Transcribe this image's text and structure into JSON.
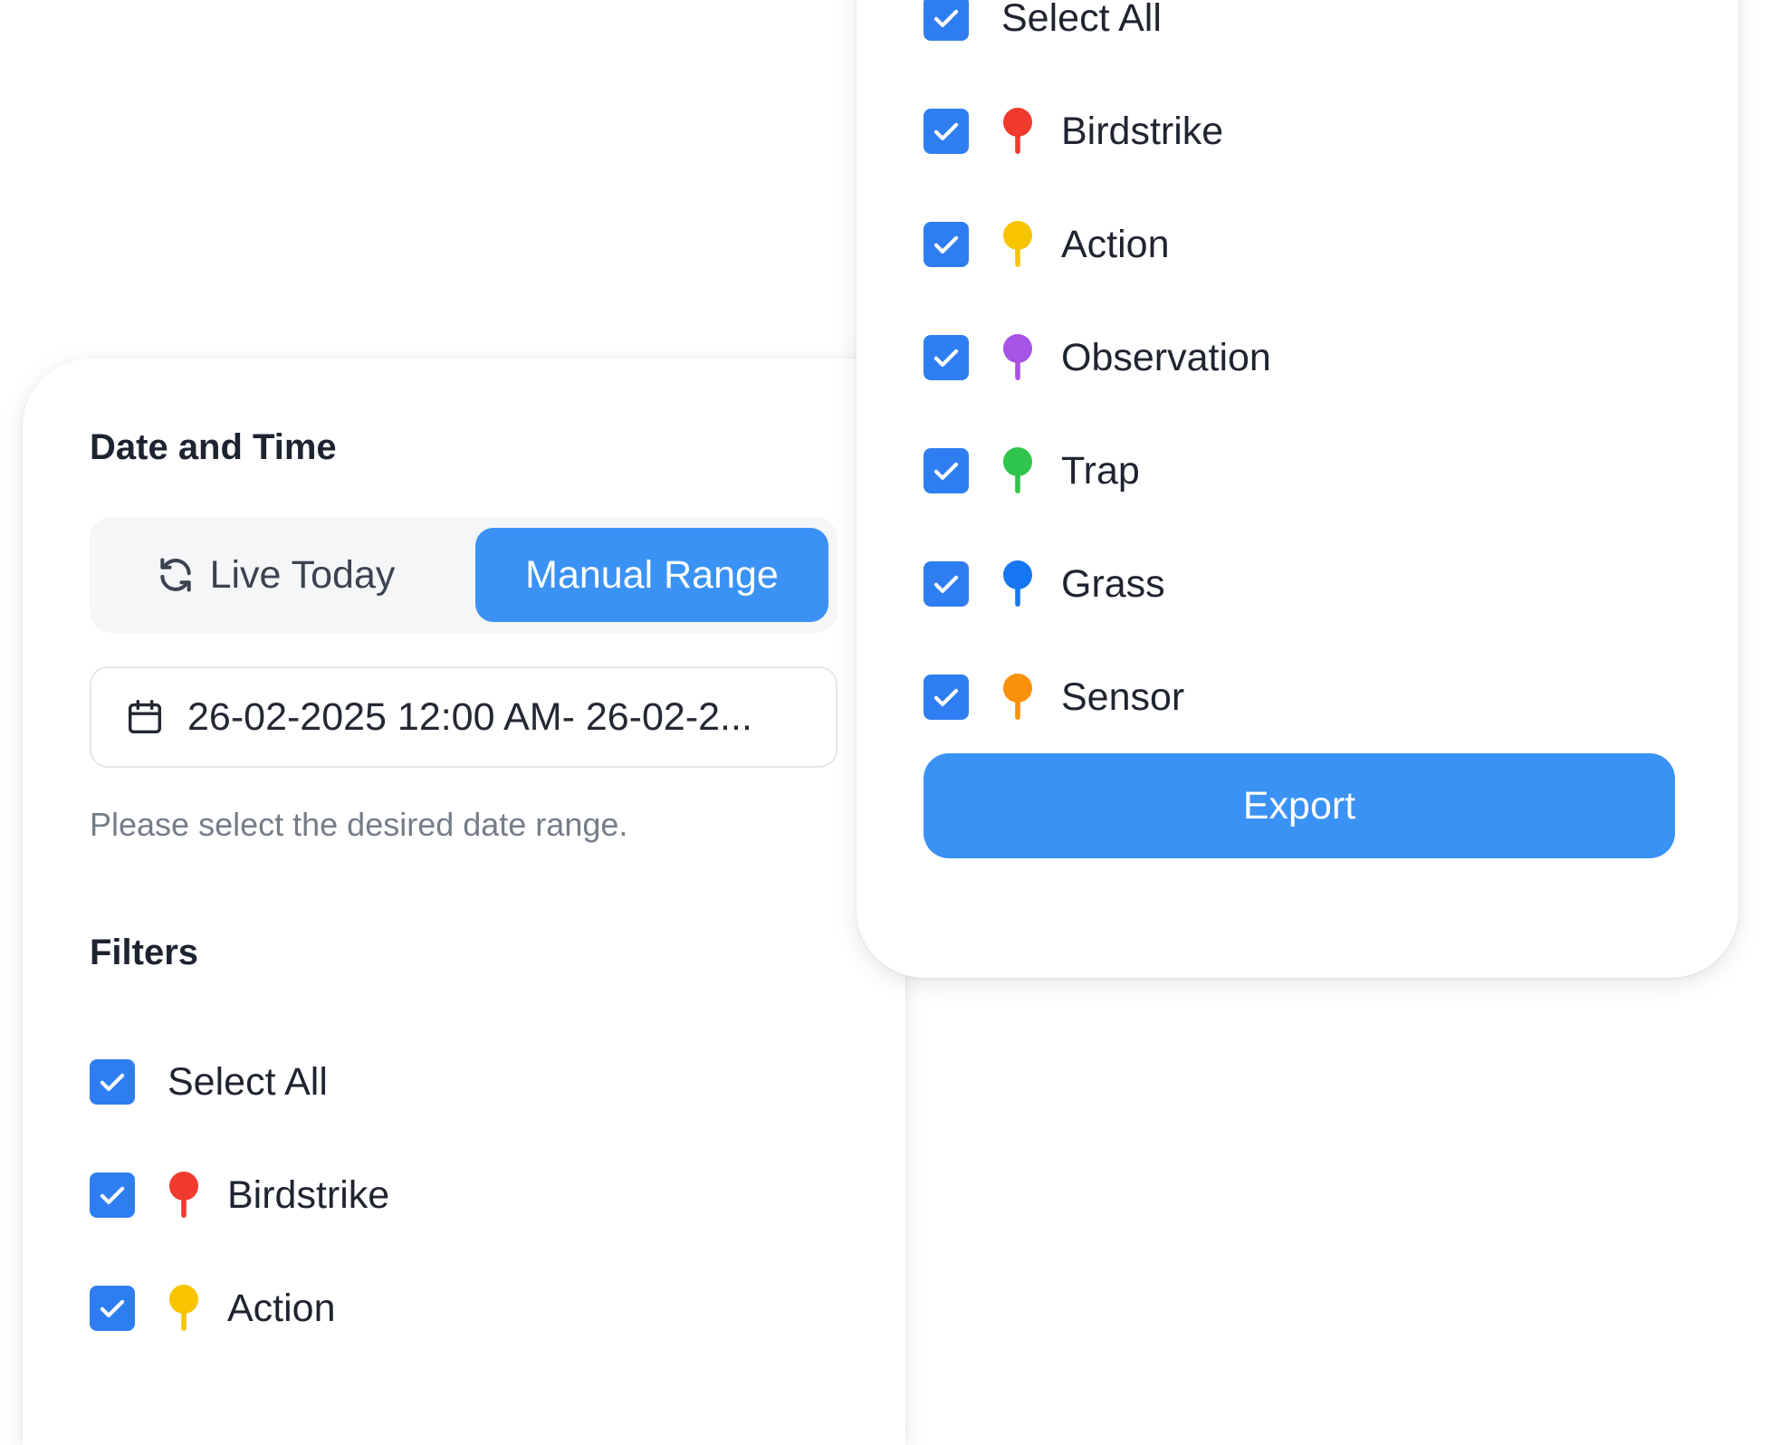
{
  "date_time_title": "Date and Time",
  "mode_toggle": {
    "live_label": "Live Today",
    "manual_label": "Manual Range",
    "selected": "Manual Range"
  },
  "date_range": {
    "value": "26-02-2025 12:00 AM- 26-02-2..."
  },
  "helper_text": "Please select the desired date range.",
  "filters_title": "Filters",
  "filters": {
    "select_all": "Select All",
    "items": [
      {
        "label": "Birdstrike",
        "color": "#f03a2e",
        "checked": true
      },
      {
        "label": "Action",
        "color": "#f7c400",
        "checked": true
      },
      {
        "label": "Observation",
        "color": "#a753e6",
        "checked": true
      },
      {
        "label": "Trap",
        "color": "#2fc44b",
        "checked": true
      },
      {
        "label": "Grass",
        "color": "#1677f2",
        "checked": true
      },
      {
        "label": "Sensor",
        "color": "#f7920a",
        "checked": true
      }
    ]
  },
  "colors": {
    "accent": "#3a92f5",
    "checkbox": "#2f7ef1"
  },
  "export_label": "Export"
}
